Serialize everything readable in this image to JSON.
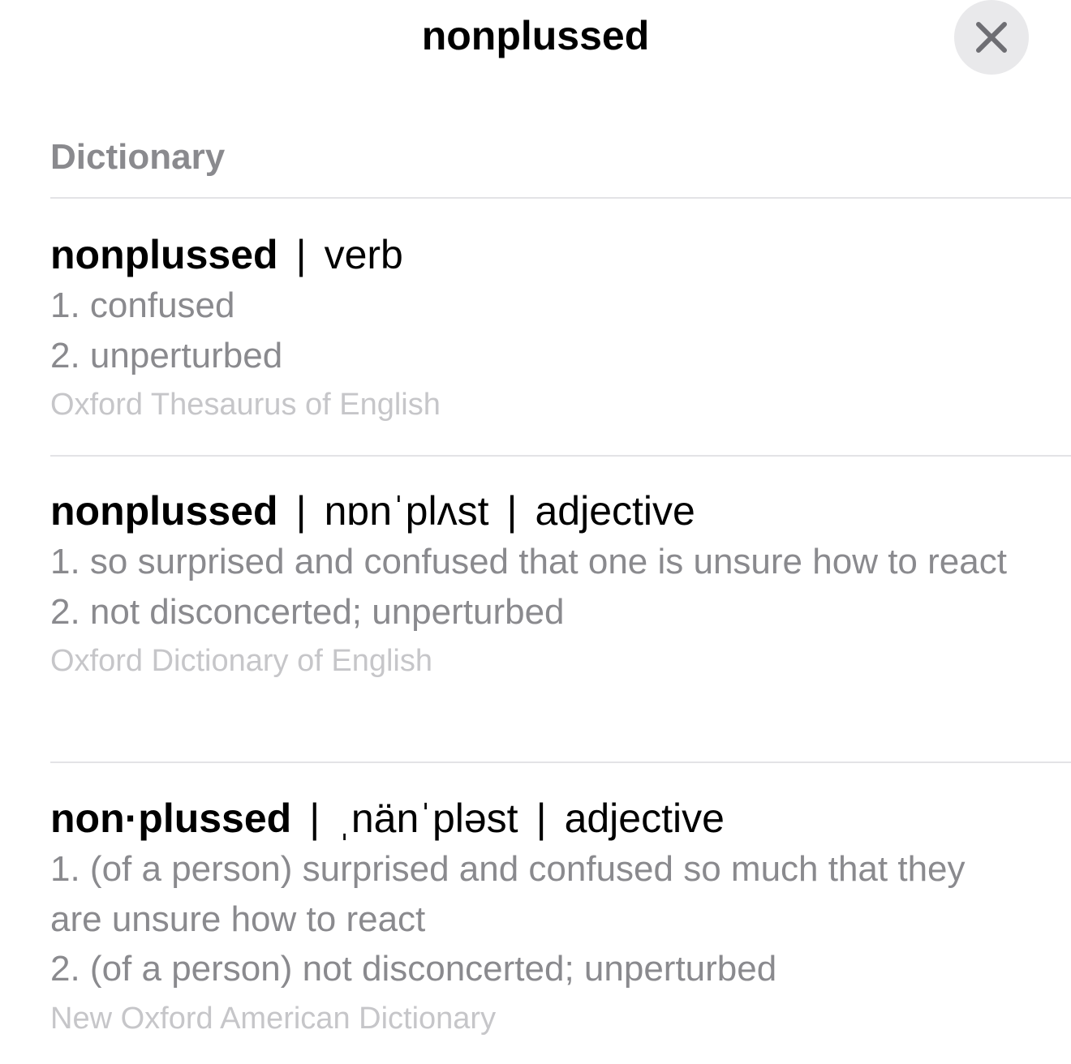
{
  "colors": {
    "background": "#ffffff",
    "heading": "#000000",
    "section_header": "#8a8a8e",
    "definition": "#8a8a8e",
    "source": "#c6c6c9",
    "divider": "#e3e3e6",
    "close_button_bg": "#e9e9eb",
    "close_icon": "#6e6e73"
  },
  "header": {
    "title": "nonplussed",
    "close_icon": "close-icon"
  },
  "section": {
    "title": "Dictionary"
  },
  "entries": [
    {
      "word": "nonplussed",
      "pronunciation": "",
      "part_of_speech": "verb",
      "definitions": [
        "1. confused",
        "2. unperturbed"
      ],
      "source": "Oxford Thesaurus of English"
    },
    {
      "word": "nonplussed",
      "pronunciation": "nɒnˈplʌst",
      "part_of_speech": "adjective",
      "definitions": [
        "1. so surprised and confused that one is unsure how to react",
        "2. not disconcerted; unperturbed"
      ],
      "source": "Oxford Dictionary of English"
    },
    {
      "word": "non·plussed",
      "pronunciation": "ˌnänˈpləst",
      "part_of_speech": "adjective",
      "definitions": [
        "1. (of a person) surprised and confused so much that they are unsure how to react",
        "2. (of a person) not disconcerted; unperturbed"
      ],
      "source": "New Oxford American Dictionary"
    }
  ],
  "separator": "|"
}
